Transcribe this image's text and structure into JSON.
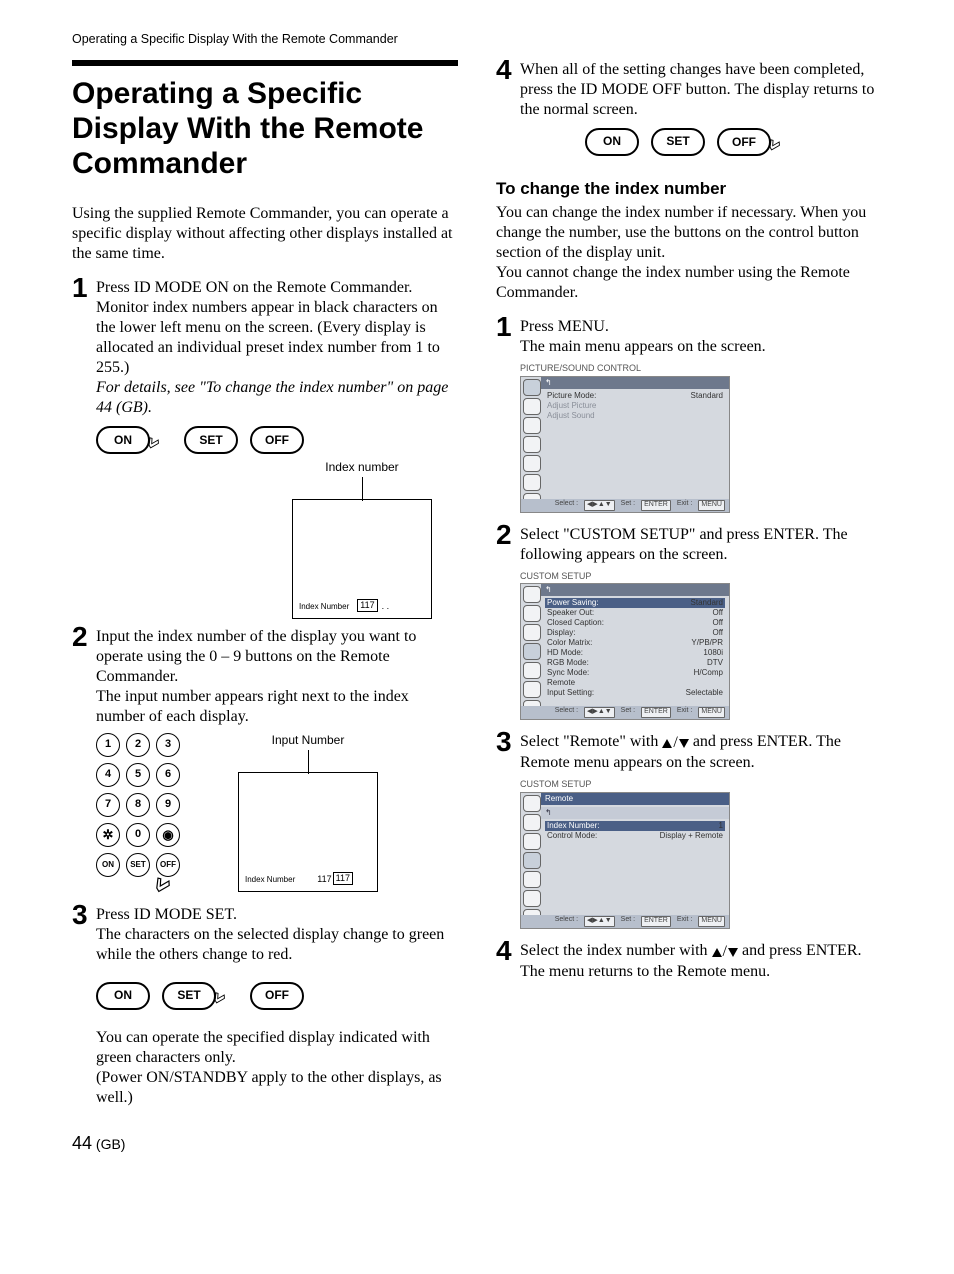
{
  "runningHead": "Operating a Specific Display With the Remote Commander",
  "title": "Operating a Specific Display With the Remote Commander",
  "intro": "Using the supplied Remote Commander, you can operate a specific display without affecting other displays installed at the same time.",
  "left": {
    "steps": [
      {
        "no": "1",
        "body": "Press ID MODE ON on the Remote Commander. Monitor index numbers appear in black characters on the lower left menu on the screen. (Every display is allocated an individual preset index number from 1 to 255.)",
        "note": "For details, see \"To change the index number\" on page 44 (GB)."
      },
      {
        "no": "2",
        "body": "Input the index number of the display you want to operate using the 0 – 9 buttons on the Remote Commander.",
        "body2": "The input number appears right next to the index number of each display."
      },
      {
        "no": "3",
        "body": "Press ID MODE SET.",
        "body2": "The characters on the selected display change to green while the others change to red.",
        "body3": "You can operate the specified display indicated with green characters only.",
        "body4": "(Power ON/STANDBY apply to the other displays, as well.)"
      }
    ],
    "pills": {
      "on": "ON",
      "set": "SET",
      "off": "OFF"
    },
    "fig1": {
      "caption": "Index number",
      "label": "Index Number",
      "value": "117",
      "extra": ". ."
    },
    "fig2": {
      "caption": "Input Number",
      "label": "Index Number",
      "value": "117",
      "rightValue": "117"
    },
    "keypad": [
      "1",
      "2",
      "3",
      "4",
      "5",
      "6",
      "7",
      "8",
      "9",
      "sun",
      "0",
      "spiral",
      "ON",
      "SET",
      "OFF"
    ]
  },
  "right": {
    "step4": {
      "no": "4",
      "body": "When all of the setting changes have been completed, press the ID MODE OFF button. The display returns to the normal screen."
    },
    "pills": {
      "on": "ON",
      "set": "SET",
      "off": "OFF"
    },
    "subhead": "To change the index number",
    "subpara": "You can change the index number if necessary. When you change the number, use the buttons on the control button section of the display unit.\nYou cannot change the index number using the Remote Commander.",
    "steps": [
      {
        "no": "1",
        "body": "Press MENU.",
        "body2": "The main menu appears on the screen."
      },
      {
        "no": "2",
        "body": "Select \"CUSTOM SETUP\" and press ENTER. The following appears on the screen."
      },
      {
        "no": "3",
        "body_pre": "Select \"Remote\" with ",
        "body_post": " and press ENTER. The Remote menu appears on the screen."
      },
      {
        "no": "4",
        "body_pre": "Select the index number with ",
        "body_post": " and press ENTER.",
        "body2": "The menu returns to the Remote menu."
      }
    ],
    "menus": {
      "m1": {
        "title": "PICTURE/SOUND CONTROL",
        "back": "↰",
        "lines": [
          {
            "l": "Picture Mode:",
            "v": "Standard"
          },
          {
            "l": "Adjust Picture",
            "dim": true
          },
          {
            "l": "Adjust Sound",
            "dim": true
          }
        ]
      },
      "m2": {
        "title": "CUSTOM SETUP",
        "back": "↰",
        "lines": [
          {
            "l": "Power Saving:",
            "v": "Standard",
            "hl": true
          },
          {
            "l": "Speaker Out:",
            "v": "Off"
          },
          {
            "l": "Closed Caption:",
            "v": "Off"
          },
          {
            "l": "Display:",
            "v": "Off"
          },
          {
            "l": "Color Matrix:",
            "v": "Y/PB/PR"
          },
          {
            "l": "HD Mode:",
            "v": "1080i"
          },
          {
            "l": "RGB Mode:",
            "v": "DTV"
          },
          {
            "l": "Sync Mode:",
            "v": "H/Comp"
          },
          {
            "l": "Remote"
          },
          {
            "l": "Input Setting:",
            "v": "Selectable"
          }
        ]
      },
      "m3": {
        "title": "CUSTOM SETUP",
        "tab": "Remote",
        "back": "↰",
        "lines": [
          {
            "l": "Index Number:",
            "v": "1",
            "hl": true
          },
          {
            "l": "Control Mode:",
            "v": "Display + Remote"
          }
        ]
      },
      "footer": {
        "select": "Select :",
        "navchip": "◀▶▲▼",
        "set": "Set :",
        "setchip": "ENTER",
        "exit": "Exit :",
        "exitchip": "MENU"
      }
    }
  },
  "page": {
    "big": "44",
    "suffix": " (GB)"
  }
}
